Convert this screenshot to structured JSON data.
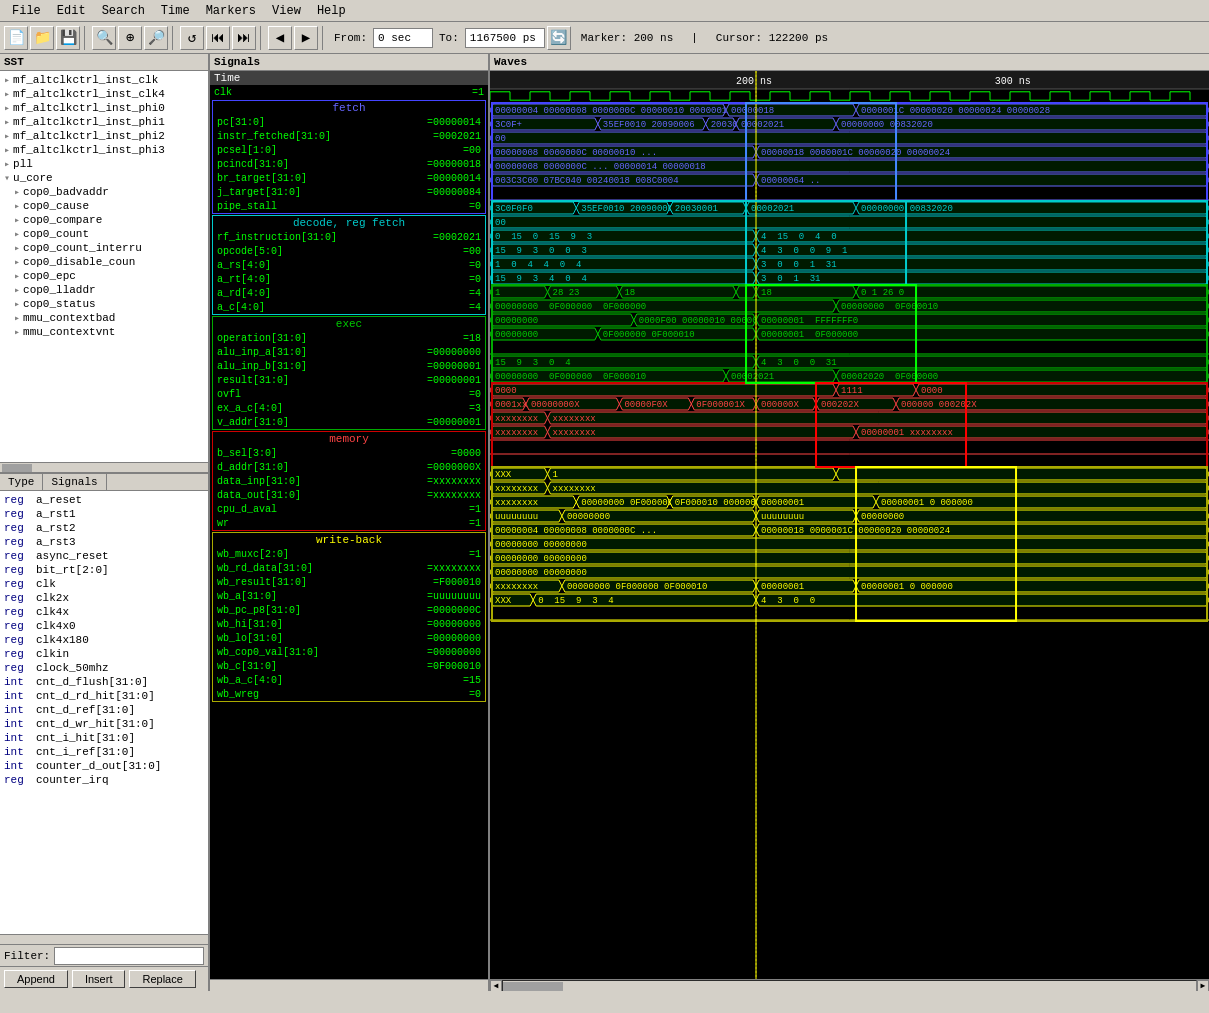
{
  "menubar": {
    "items": [
      "File",
      "Edit",
      "Search",
      "Time",
      "Markers",
      "View",
      "Help"
    ]
  },
  "toolbar": {
    "from_label": "From:",
    "from_value": "0 sec",
    "to_label": "To:",
    "to_value": "1167500 ps",
    "marker_info": "Marker: 200 ns",
    "cursor_info": "Cursor: 122200 ps"
  },
  "sst": {
    "title": "SST",
    "items": [
      {
        "indent": 0,
        "icon": "▸",
        "name": "mf_altclkctrl_inst_clk"
      },
      {
        "indent": 0,
        "icon": "▸",
        "name": "mf_altclkctrl_inst_clk4"
      },
      {
        "indent": 0,
        "icon": "▸",
        "name": "mf_altclkctrl_inst_phi0"
      },
      {
        "indent": 0,
        "icon": "▸",
        "name": "mf_altclkctrl_inst_phi1"
      },
      {
        "indent": 0,
        "icon": "▸",
        "name": "mf_altclkctrl_inst_phi2"
      },
      {
        "indent": 0,
        "icon": "▸",
        "name": "mf_altclkctrl_inst_phi3"
      },
      {
        "indent": 0,
        "icon": "▸",
        "name": "pll"
      },
      {
        "indent": 0,
        "icon": "▾",
        "name": "u_core"
      },
      {
        "indent": 1,
        "icon": "▸",
        "name": "cop0_badvaddr"
      },
      {
        "indent": 1,
        "icon": "▸",
        "name": "cop0_cause"
      },
      {
        "indent": 1,
        "icon": "▸",
        "name": "cop0_compare"
      },
      {
        "indent": 1,
        "icon": "▸",
        "name": "cop0_count"
      },
      {
        "indent": 1,
        "icon": "▸",
        "name": "cop0_count_interru"
      },
      {
        "indent": 1,
        "icon": "▸",
        "name": "cop0_disable_coun"
      },
      {
        "indent": 1,
        "icon": "▸",
        "name": "cop0_epc"
      },
      {
        "indent": 1,
        "icon": "▸",
        "name": "cop0_lladdr"
      },
      {
        "indent": 1,
        "icon": "▸",
        "name": "cop0_status"
      },
      {
        "indent": 1,
        "icon": "▸",
        "name": "mmu_contextbad"
      },
      {
        "indent": 1,
        "icon": "▸",
        "name": "mmu_contextvnt"
      }
    ]
  },
  "type_signals": {
    "tab_type": "Type",
    "tab_signals": "Signals",
    "items": [
      {
        "type": "reg",
        "name": "a_reset"
      },
      {
        "type": "reg",
        "name": "a_rst1"
      },
      {
        "type": "reg",
        "name": "a_rst2"
      },
      {
        "type": "reg",
        "name": "a_rst3"
      },
      {
        "type": "reg",
        "name": "async_reset"
      },
      {
        "type": "reg",
        "name": "bit_rt[2:0]"
      },
      {
        "type": "reg",
        "name": "clk"
      },
      {
        "type": "reg",
        "name": "clk2x"
      },
      {
        "type": "reg",
        "name": "clk4x"
      },
      {
        "type": "reg",
        "name": "clk4x0"
      },
      {
        "type": "reg",
        "name": "clk4x180"
      },
      {
        "type": "reg",
        "name": "clkin"
      },
      {
        "type": "reg",
        "name": "clock_50mhz"
      },
      {
        "type": "int",
        "name": "cnt_d_flush[31:0]"
      },
      {
        "type": "int",
        "name": "cnt_d_rd_hit[31:0]"
      },
      {
        "type": "int",
        "name": "cnt_d_ref[31:0]"
      },
      {
        "type": "int",
        "name": "cnt_d_wr_hit[31:0]"
      },
      {
        "type": "int",
        "name": "cnt_i_hit[31:0]"
      },
      {
        "type": "int",
        "name": "cnt_i_ref[31:0]"
      },
      {
        "type": "int",
        "name": "counter_d_out[31:0]"
      },
      {
        "type": "reg",
        "name": "counter_irq"
      }
    ]
  },
  "filter": {
    "label": "Filter:",
    "value": "",
    "placeholder": ""
  },
  "actions": {
    "append": "Append",
    "insert": "Insert",
    "replace": "Replace"
  },
  "signals_panel": {
    "title": "Signals",
    "time_col": "Time",
    "clk_val": "=1",
    "groups": {
      "fetch": {
        "title": "fetch",
        "color": "blue",
        "signals": [
          {
            "name": "pc[31:0]",
            "val": "=00000014"
          },
          {
            "name": "instr_fetched[31:0]",
            "val": "=0002021"
          },
          {
            "name": "pcsel[1:0]",
            "val": "=00"
          },
          {
            "name": "pcincd[31:0]",
            "val": "=00000018"
          },
          {
            "name": "br_target[31:0]",
            "val": "=00000014"
          },
          {
            "name": "j_target[31:0]",
            "val": "=00000084"
          },
          {
            "name": "pipe_stall",
            "val": "=0"
          }
        ]
      },
      "decode": {
        "title": "decode, reg fetch",
        "color": "cyan",
        "signals": [
          {
            "name": "rf_instruction[31:0]",
            "val": "=0002021"
          },
          {
            "name": "opcode[5:0]",
            "val": "=00"
          },
          {
            "name": "a_rs[4:0]",
            "val": "=0"
          },
          {
            "name": "a_rt[4:0]",
            "val": "=0"
          },
          {
            "name": "a_rd[4:0]",
            "val": "=4"
          },
          {
            "name": "a_c[4:0]",
            "val": "=4"
          }
        ]
      },
      "exec": {
        "title": "exec",
        "color": "green",
        "signals": [
          {
            "name": "operation[31:0]",
            "val": "=18"
          },
          {
            "name": "alu_inp_a[31:0]",
            "val": "=00000000"
          },
          {
            "name": "alu_inp_b[31:0]",
            "val": "=00000001"
          },
          {
            "name": "result[31:0]",
            "val": "=00000001"
          },
          {
            "name": "ovfl",
            "val": "=0"
          },
          {
            "name": "ex_a_c[4:0]",
            "val": "=3"
          },
          {
            "name": "v_addr[31:0]",
            "val": "=00000001"
          }
        ]
      },
      "memory": {
        "title": "memory",
        "color": "red",
        "signals": [
          {
            "name": "b_sel[3:0]",
            "val": "=0000"
          },
          {
            "name": "d_addr[31:0]",
            "val": "=0000000X"
          },
          {
            "name": "data_inp[31:0]",
            "val": "=xxxxxxxx"
          },
          {
            "name": "data_out[31:0]",
            "val": "=xxxxxxxx"
          },
          {
            "name": "cpu_d_aval",
            "val": "=1"
          },
          {
            "name": "wr",
            "val": "=1"
          }
        ]
      },
      "writeback": {
        "title": "write-back",
        "color": "yellow",
        "signals": [
          {
            "name": "wb_muxc[2:0]",
            "val": "=1"
          },
          {
            "name": "wb_rd_data[31:0]",
            "val": "=xxxxxxxx"
          },
          {
            "name": "wb_result[31:0]",
            "val": "=F000010"
          },
          {
            "name": "wb_a[31:0]",
            "val": "=uuuuuuuu"
          },
          {
            "name": "wb_pc_p8[31:0]",
            "val": "=0000000C"
          },
          {
            "name": "wb_hi[31:0]",
            "val": "=00000000"
          },
          {
            "name": "wb_lo[31:0]",
            "val": "=00000000"
          },
          {
            "name": "wb_cop0_val[31:0]",
            "val": "=00000000"
          },
          {
            "name": "wb_c[31:0]",
            "val": "=0F000010"
          },
          {
            "name": "wb_a_c[4:0]",
            "val": "=15"
          },
          {
            "name": "wb_wreg",
            "val": "=0"
          }
        ]
      }
    }
  },
  "waves": {
    "title": "Waves",
    "time_marks": [
      {
        "pos": "35%",
        "label": "200 ns"
      },
      {
        "pos": "72%",
        "label": "300 ns"
      }
    ]
  }
}
